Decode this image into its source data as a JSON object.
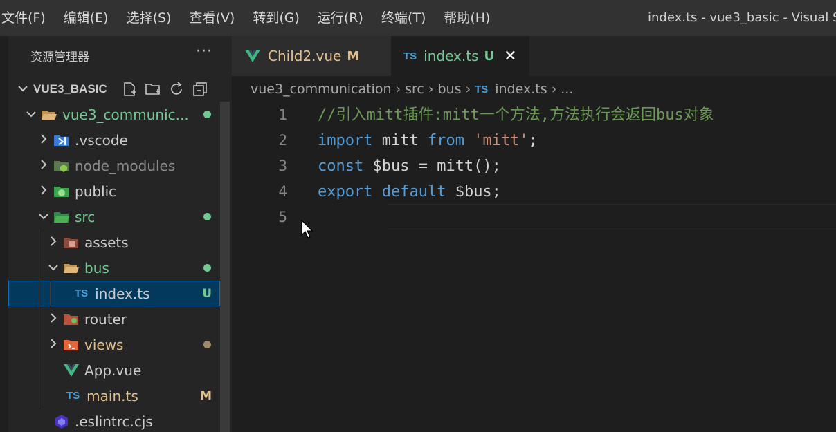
{
  "menu": [
    "文件(F)",
    "编辑(E)",
    "选择(S)",
    "查看(V)",
    "转到(G)",
    "运行(R)",
    "终端(T)",
    "帮助(H)"
  ],
  "window_title": "index.ts - vue3_basic - Visual S",
  "explorer": {
    "header": "资源管理器",
    "more": "···",
    "root_label": "VUE3_BASIC",
    "tree": [
      {
        "label": "vue3_communic...",
        "depth": 1,
        "chevron": "⌄",
        "icon": "folder-open-icon",
        "color": "green",
        "dot": "green"
      },
      {
        "label": ".vscode",
        "depth": 2,
        "chevron": "›",
        "icon": "vscode-folder-icon",
        "color": "normal"
      },
      {
        "label": "node_modules",
        "depth": 2,
        "chevron": "›",
        "icon": "node-folder-icon",
        "color": "dim"
      },
      {
        "label": "public",
        "depth": 2,
        "chevron": "›",
        "icon": "public-folder-icon",
        "color": "normal"
      },
      {
        "label": "src",
        "depth": 2,
        "chevron": "⌄",
        "icon": "src-folder-icon",
        "color": "green",
        "dot": "green"
      },
      {
        "label": "assets",
        "depth": 3,
        "chevron": "›",
        "icon": "assets-folder-icon",
        "color": "normal"
      },
      {
        "label": "bus",
        "depth": 3,
        "chevron": "⌄",
        "icon": "folder-open-icon",
        "color": "green",
        "dot": "green"
      },
      {
        "label": "index.ts",
        "depth": 4,
        "chevron": "",
        "icon": "typescript-file-icon",
        "color": "normal",
        "badge": "U",
        "selected": true
      },
      {
        "label": "router",
        "depth": 3,
        "chevron": "›",
        "icon": "router-folder-icon",
        "color": "normal"
      },
      {
        "label": "views",
        "depth": 3,
        "chevron": "›",
        "icon": "views-folder-icon",
        "color": "modified",
        "dot": "brown"
      },
      {
        "label": "App.vue",
        "depth": 3,
        "chevron": "",
        "icon": "vue-file-icon",
        "color": "normal"
      },
      {
        "label": "main.ts",
        "depth": 3,
        "chevron": "",
        "icon": "typescript-file-icon",
        "color": "modified",
        "badge": "M"
      },
      {
        "label": ".eslintrc.cjs",
        "depth": 2,
        "chevron": "",
        "icon": "eslint-file-icon",
        "color": "normal"
      }
    ]
  },
  "tabs": [
    {
      "label": "Child2.vue",
      "badge": "M",
      "active": false,
      "icon": "vue-file-icon"
    },
    {
      "label": "index.ts",
      "badge": "U",
      "active": true,
      "icon": "typescript-file-icon",
      "close": "✕"
    }
  ],
  "breadcrumb": [
    "vue3_communication",
    "src",
    "bus",
    "index.ts",
    "..."
  ],
  "code_lines": [
    {
      "n": "1",
      "tokens": [
        {
          "t": "//引入mitt插件:mitt一个方法,方法执行会返回bus对象",
          "c": "comment"
        }
      ]
    },
    {
      "n": "2",
      "tokens": [
        {
          "t": "import",
          "c": "kw"
        },
        {
          "t": " mitt ",
          "c": "ident"
        },
        {
          "t": "from",
          "c": "kw"
        },
        {
          "t": " ",
          "c": "ident"
        },
        {
          "t": "'mitt'",
          "c": "str"
        },
        {
          "t": ";",
          "c": "ident"
        }
      ]
    },
    {
      "n": "3",
      "tokens": [
        {
          "t": "const",
          "c": "kw"
        },
        {
          "t": " $bus = mitt();",
          "c": "ident"
        }
      ]
    },
    {
      "n": "4",
      "tokens": [
        {
          "t": "export",
          "c": "kw"
        },
        {
          "t": " ",
          "c": "ident"
        },
        {
          "t": "default",
          "c": "kw"
        },
        {
          "t": " $bus;",
          "c": "ident"
        }
      ]
    },
    {
      "n": "5",
      "tokens": []
    }
  ],
  "colors": {
    "accent": "#0e70c0",
    "untracked": "#73c991",
    "modified": "#e2c08d",
    "keyword": "#569cd6",
    "comment": "#6a9955",
    "string": "#ce9178"
  }
}
